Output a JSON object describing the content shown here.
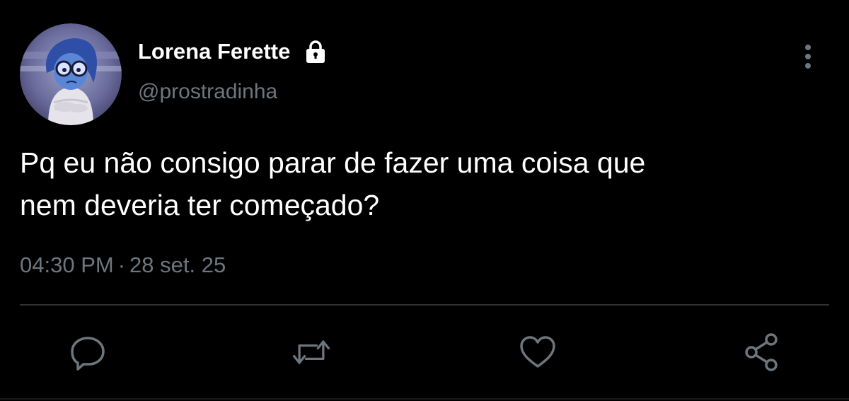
{
  "tweet": {
    "author": {
      "display_name": "Lorena Ferette",
      "handle": "@prostradinha",
      "protected_icon": "lock-icon",
      "avatar": "sadness-character-avatar"
    },
    "text_line_1": "Pq eu não consigo parar de fazer uma coisa que",
    "text_line_2": "nem deveria ter começado?",
    "time": "04:30 PM",
    "separator": "·",
    "date": "28 set. 25",
    "menu_icon": "more-vertical-icon"
  },
  "actions": [
    {
      "name": "reply",
      "icon": "reply-icon"
    },
    {
      "name": "retweet",
      "icon": "retweet-icon"
    },
    {
      "name": "like",
      "icon": "heart-icon"
    },
    {
      "name": "share",
      "icon": "share-icon"
    }
  ],
  "colors": {
    "background": "#000000",
    "primary_text": "#ffffff",
    "secondary_text": "#6e767d",
    "icon": "#6e767d",
    "divider": "#2f3336"
  }
}
